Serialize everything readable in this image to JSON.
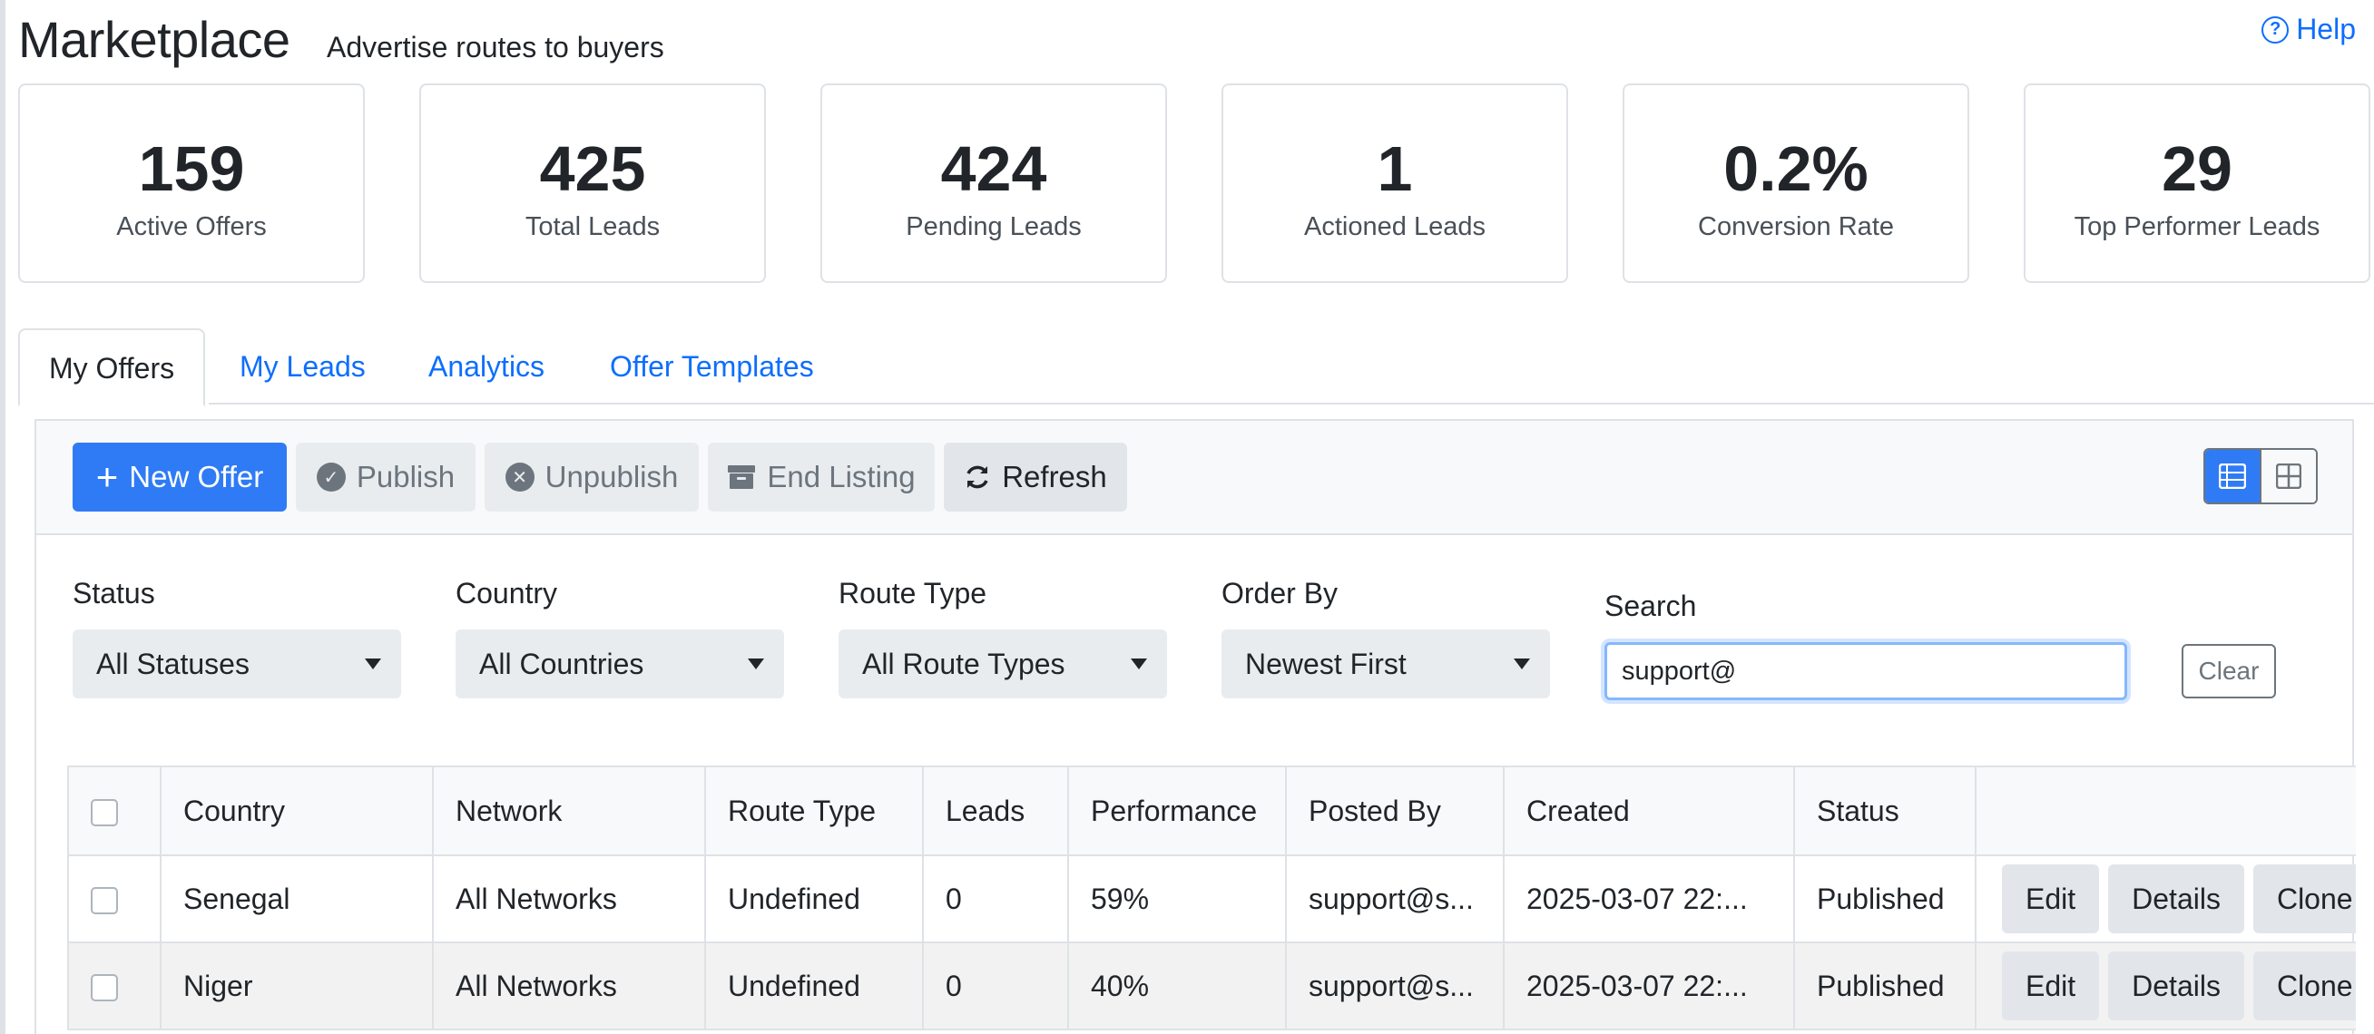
{
  "header": {
    "title": "Marketplace",
    "subtitle": "Advertise routes to buyers",
    "help_label": "Help"
  },
  "stats": [
    {
      "value": "159",
      "label": "Active Offers"
    },
    {
      "value": "425",
      "label": "Total Leads"
    },
    {
      "value": "424",
      "label": "Pending Leads"
    },
    {
      "value": "1",
      "label": "Actioned Leads"
    },
    {
      "value": "0.2%",
      "label": "Conversion Rate"
    },
    {
      "value": "29",
      "label": "Top Performer Leads"
    }
  ],
  "tabs": [
    {
      "label": "My Offers",
      "active": true
    },
    {
      "label": "My Leads",
      "active": false
    },
    {
      "label": "Analytics",
      "active": false
    },
    {
      "label": "Offer Templates",
      "active": false
    }
  ],
  "toolbar": {
    "new_offer": "New Offer",
    "publish": "Publish",
    "unpublish": "Unpublish",
    "end_listing": "End Listing",
    "refresh": "Refresh"
  },
  "filters": {
    "status": {
      "label": "Status",
      "value": "All Statuses"
    },
    "country": {
      "label": "Country",
      "value": "All Countries"
    },
    "route_type": {
      "label": "Route Type",
      "value": "All Route Types"
    },
    "order_by": {
      "label": "Order By",
      "value": "Newest First"
    },
    "search": {
      "label": "Search",
      "value": "support@"
    },
    "clear_label": "Clear"
  },
  "table": {
    "columns": [
      "Country",
      "Network",
      "Route Type",
      "Leads",
      "Performance",
      "Posted By",
      "Created",
      "Status"
    ],
    "rows": [
      {
        "country": "Senegal",
        "network": "All Networks",
        "route_type": "Undefined",
        "leads": "0",
        "performance": "59%",
        "posted_by": "support@s...",
        "created": "2025-03-07 22:...",
        "status": "Published"
      },
      {
        "country": "Niger",
        "network": "All Networks",
        "route_type": "Undefined",
        "leads": "0",
        "performance": "40%",
        "posted_by": "support@s...",
        "created": "2025-03-07 22:...",
        "status": "Published"
      }
    ],
    "actions": {
      "edit": "Edit",
      "details": "Details",
      "clone": "Clone"
    }
  },
  "colors": {
    "primary": "#2f7bf5",
    "link": "#0d6efd",
    "border": "#dee2e6",
    "muted_button": "#e9ecef"
  }
}
